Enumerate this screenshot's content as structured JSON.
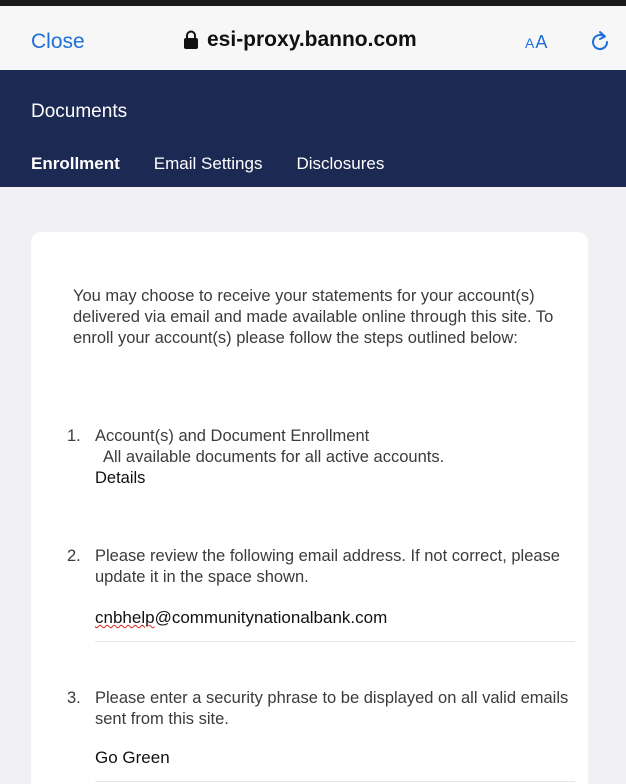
{
  "browser": {
    "close_label": "Close",
    "url": "esi-proxy.banno.com",
    "text_size_label_small": "A",
    "text_size_label_large": "A"
  },
  "header": {
    "title": "Documents",
    "tabs": [
      {
        "label": "Enrollment",
        "active": true
      },
      {
        "label": "Email Settings",
        "active": false
      },
      {
        "label": "Disclosures",
        "active": false
      }
    ]
  },
  "content": {
    "intro": "You may choose to receive your statements for your account(s) delivered via email and made available online through this site. To enroll your account(s) please follow the steps outlined below:",
    "steps": [
      {
        "number": "1.",
        "title": "Account(s) and Document Enrollment",
        "description": "All available documents for all active accounts.",
        "link": "Details"
      },
      {
        "number": "2.",
        "title": "Please review the following email address. If not correct, please update it in the space shown.",
        "value": "cnbhelp@communitynationalbank.com",
        "value_prefix": "cnbhelp",
        "value_suffix": "@communitynationalbank.com"
      },
      {
        "number": "3.",
        "title": "Please enter a security phrase to be displayed on all valid emails sent from this site.",
        "value": "Go Green"
      }
    ]
  },
  "colors": {
    "header_bg": "#1c2953",
    "link_blue": "#1e6fd9",
    "page_bg": "#f1f1f4"
  }
}
